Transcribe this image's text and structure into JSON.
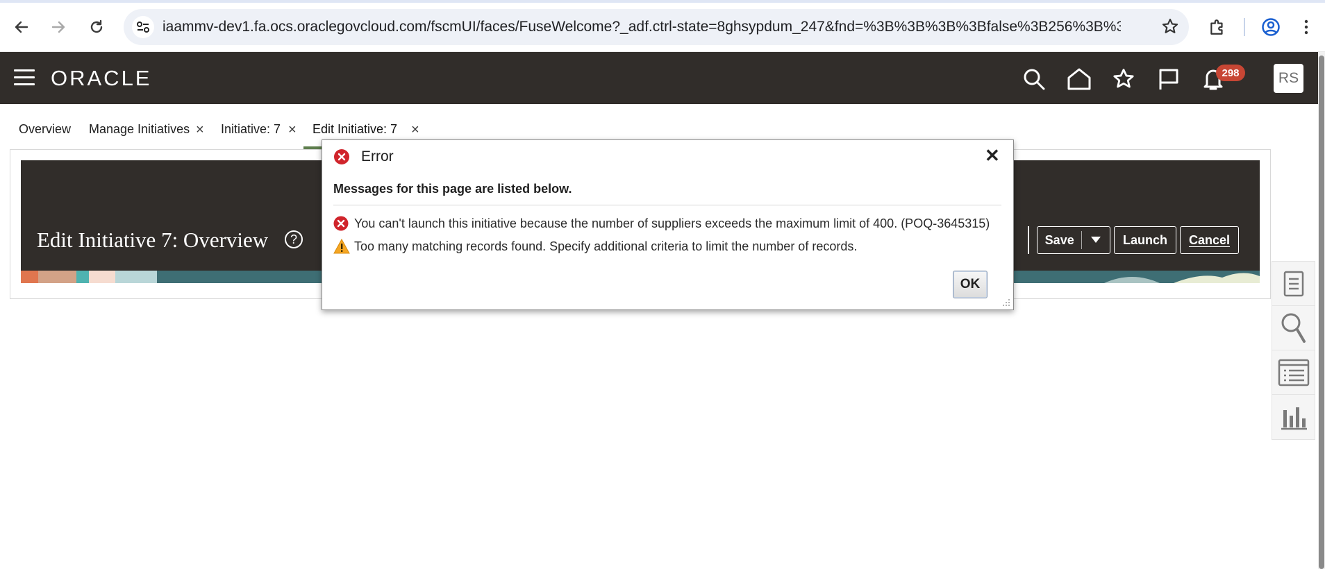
{
  "browser": {
    "url": "iaammv-dev1.fa.ocs.oraclegovcloud.com/fscmUI/faces/FuseWelcome?_adf.ctrl-state=8ghsypdum_247&fnd=%3B%3B%3B%3Bfalse%3B256%3B%3B%3..."
  },
  "header": {
    "logo": "ORACLE",
    "notifications_count": "298",
    "avatar_initials": "RS"
  },
  "tabs": [
    {
      "label": "Overview"
    },
    {
      "label": "Manage Initiatives"
    },
    {
      "label": "Initiative: 7"
    },
    {
      "label": "Edit Initiative: 7"
    }
  ],
  "page": {
    "title": "Edit Initiative 7: Overview",
    "help": "?",
    "buttons": {
      "save": "Save",
      "launch": "Launch",
      "cancel": "Cancel"
    }
  },
  "dialog": {
    "title": "Error",
    "heading": "Messages for this page are listed below.",
    "messages": [
      {
        "type": "error",
        "text": "You can't launch this initiative because the number of suppliers exceeds the maximum limit of 400. (POQ-3645315)"
      },
      {
        "type": "warning",
        "text": "Too many matching records found. Specify additional criteria to limit the number of records."
      }
    ],
    "ok_label": "OK"
  },
  "colors": {
    "header_bg": "#312d2a",
    "badge": "#c74634",
    "error": "#d0242b",
    "warning": "#f5a623",
    "active_tab_underline": "#5e7e4d"
  }
}
